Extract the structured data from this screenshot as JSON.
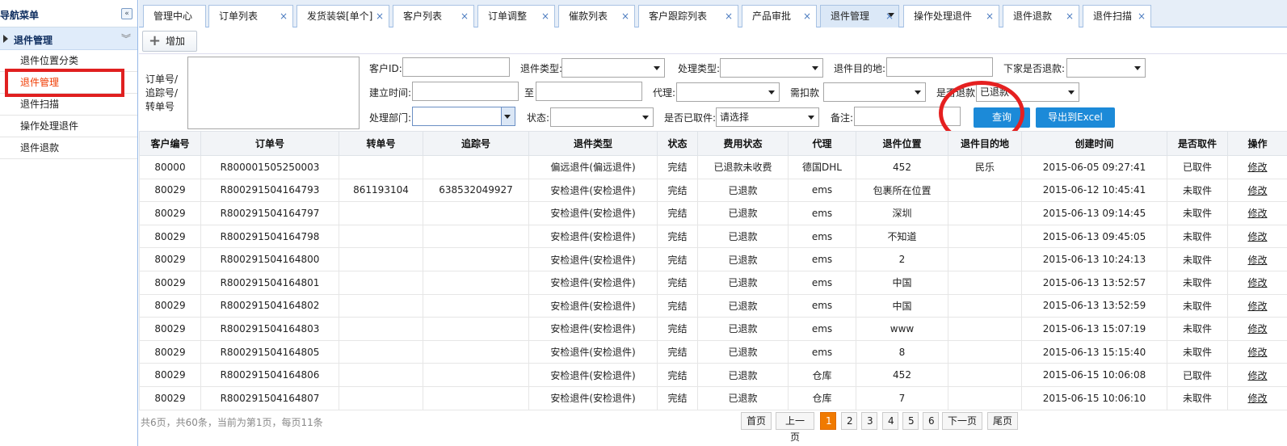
{
  "sidebar": {
    "title": "导航菜单",
    "collapse": "«",
    "group": "退件管理",
    "group_toggle": "»",
    "items": [
      {
        "label": "退件位置分类"
      },
      {
        "label": "退件管理"
      },
      {
        "label": "退件扫描"
      },
      {
        "label": "操作处理退件"
      },
      {
        "label": "退件退款"
      }
    ]
  },
  "tabs": [
    {
      "label": "管理中心"
    },
    {
      "label": "订单列表"
    },
    {
      "label": "发货装袋[单个]"
    },
    {
      "label": "客户列表"
    },
    {
      "label": "订单调整"
    },
    {
      "label": "催款列表"
    },
    {
      "label": "客户跟踪列表"
    },
    {
      "label": "产品审批"
    },
    {
      "label": "退件管理"
    },
    {
      "label": "操作处理退件"
    },
    {
      "label": "退件退款"
    },
    {
      "label": "退件扫描"
    }
  ],
  "tab_close": "×",
  "toolbar": {
    "add_label": "增加",
    "add_icon": "plus-icon",
    "plus": "+"
  },
  "filter": {
    "order_label": "订单号/追踪号/转单号",
    "customer_id": "客户ID:",
    "return_type": "退件类型:",
    "handle_type": "处理类型:",
    "destination": "退件目的地:",
    "subordinate_refund": "下家是否退款:",
    "created_time": "建立时间:",
    "to": "至",
    "agent": "代理:",
    "deduction": "需扣款",
    "is_refunded": "是否退款",
    "is_refunded_value": "已退款",
    "dept": "处理部门:",
    "status": "状态:",
    "is_picked": "是否已取件:",
    "is_picked_value": "请选择",
    "remark": "备注:",
    "query_btn": "查询",
    "export_btn": "导出到Excel"
  },
  "table": {
    "headers": [
      "客户编号",
      "订单号",
      "转单号",
      "追踪号",
      "退件类型",
      "状态",
      "费用状态",
      "代理",
      "退件位置",
      "退件目的地",
      "创建时间",
      "是否取件",
      "操作"
    ],
    "rows": [
      [
        "80000",
        "R800001505250003",
        "",
        "",
        "偏远退件(偏远退件)",
        "完结",
        "已退款未收费",
        "德国DHL",
        "452",
        "民乐",
        "2015-06-05 09:27:41",
        "已取件",
        "修改"
      ],
      [
        "80029",
        "R800291504164793",
        "861193104",
        "638532049927",
        "安检退件(安检退件)",
        "完结",
        "已退款",
        "ems",
        "包裹所在位置",
        "",
        "2015-06-12 10:45:41",
        "未取件",
        "修改"
      ],
      [
        "80029",
        "R800291504164797",
        "",
        "",
        "安检退件(安检退件)",
        "完结",
        "已退款",
        "ems",
        "深圳",
        "",
        "2015-06-13 09:14:45",
        "未取件",
        "修改"
      ],
      [
        "80029",
        "R800291504164798",
        "",
        "",
        "安检退件(安检退件)",
        "完结",
        "已退款",
        "ems",
        "不知道",
        "",
        "2015-06-13 09:45:05",
        "未取件",
        "修改"
      ],
      [
        "80029",
        "R800291504164800",
        "",
        "",
        "安检退件(安检退件)",
        "完结",
        "已退款",
        "ems",
        "2",
        "",
        "2015-06-13 10:24:13",
        "未取件",
        "修改"
      ],
      [
        "80029",
        "R800291504164801",
        "",
        "",
        "安检退件(安检退件)",
        "完结",
        "已退款",
        "ems",
        "中国",
        "",
        "2015-06-13 13:52:57",
        "未取件",
        "修改"
      ],
      [
        "80029",
        "R800291504164802",
        "",
        "",
        "安检退件(安检退件)",
        "完结",
        "已退款",
        "ems",
        "中国",
        "",
        "2015-06-13 13:52:59",
        "未取件",
        "修改"
      ],
      [
        "80029",
        "R800291504164803",
        "",
        "",
        "安检退件(安检退件)",
        "完结",
        "已退款",
        "ems",
        "www",
        "",
        "2015-06-13 15:07:19",
        "未取件",
        "修改"
      ],
      [
        "80029",
        "R800291504164805",
        "",
        "",
        "安检退件(安检退件)",
        "完结",
        "已退款",
        "ems",
        "8",
        "",
        "2015-06-13 15:15:40",
        "未取件",
        "修改"
      ],
      [
        "80029",
        "R800291504164806",
        "",
        "",
        "安检退件(安检退件)",
        "完结",
        "已退款",
        "仓库",
        "452",
        "",
        "2015-06-15 10:06:08",
        "已取件",
        "修改"
      ],
      [
        "80029",
        "R800291504164807",
        "",
        "",
        "安检退件(安检退件)",
        "完结",
        "已退款",
        "仓库",
        "7",
        "",
        "2015-06-15 10:06:10",
        "未取件",
        "修改"
      ]
    ]
  },
  "pager": {
    "summary": "共6页，共60条，当前为第1页，每页11条",
    "first": "首页",
    "prev": "上一页",
    "pages": [
      "1",
      "2",
      "3",
      "4",
      "5",
      "6"
    ],
    "current": 1,
    "next": "下一页",
    "last": "尾页"
  },
  "colors": {
    "accent": "#1c8ad8",
    "highlight": "#e52020",
    "current_page": "#f07a00"
  }
}
